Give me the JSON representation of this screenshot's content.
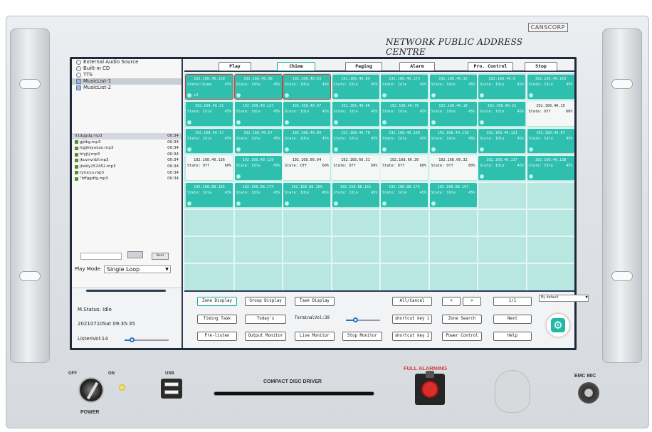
{
  "brand": "CANSCORP",
  "device_title": "NETWORK PUBLIC ADDRESS CENTRE",
  "sources": [
    {
      "label": "External Audio Source",
      "icon": "speaker-icon"
    },
    {
      "label": "Built-in CD",
      "icon": "speaker-icon"
    },
    {
      "label": "TTS",
      "icon": "speaker-icon"
    },
    {
      "label": "MusicList-1",
      "icon": "music-list-icon",
      "selected": true
    },
    {
      "label": "MusicList-2",
      "icon": "music-list-icon"
    }
  ],
  "files": [
    {
      "name": "01dggdg.mp3",
      "time": "00:34",
      "selected": true
    },
    {
      "name": "gjdkg.mp3",
      "time": "00:34"
    },
    {
      "name": "hgjjhkyuiuiu.mp3",
      "time": "00:34"
    },
    {
      "name": "htyjtj.mp3",
      "time": "00:34"
    },
    {
      "name": "jkuvnvnbf.mp3",
      "time": "00:34"
    },
    {
      "name": "jksiky252452.mp3",
      "time": "00:34"
    },
    {
      "name": "tytutyu.mp3",
      "time": "00:34"
    },
    {
      "name": "\"bffggdfg.mp3",
      "time": "00:34"
    }
  ],
  "play_controls": {
    "next_label": "Next"
  },
  "play_mode": {
    "label": "Play Mode",
    "value": "Single Loop"
  },
  "status": {
    "mstatus": "M.Status:  Idle",
    "datetime": "20210710Sat 09:35:35",
    "listen_vol": "ListenVol:14",
    "listen_vol_level": 0.18
  },
  "tabs": [
    {
      "label": "Play"
    },
    {
      "label": "Chime",
      "active": true
    },
    {
      "label": "Paging"
    },
    {
      "label": "Alarm"
    },
    {
      "label": "Pro. Control"
    },
    {
      "label": "Stop"
    }
  ],
  "zones": [
    [
      {
        "ip": "192.168.40.130",
        "state": "State:Chime",
        "vol": "45%",
        "extra": "x3",
        "sel": true
      },
      {
        "ip": "192.168.40.98",
        "state": "State: Idle",
        "vol": "45%",
        "sel": true
      },
      {
        "ip": "192.168.40.63",
        "state": "State: Idle",
        "vol": "45%",
        "sel": true
      },
      {
        "ip": "192.168.40.89",
        "state": "State: Idle",
        "vol": "45%"
      },
      {
        "ip": "192.168.40.173",
        "state": "State: Idle",
        "vol": "45%"
      },
      {
        "ip": "192.168.40.32",
        "state": "State: Idle",
        "vol": "45%"
      },
      {
        "ip": "192.168.40.9",
        "state": "State: Idle",
        "vol": "45%"
      },
      {
        "ip": "192.168.40.103",
        "state": "State: Idle",
        "vol": "45%"
      }
    ],
    [
      {
        "ip": "192.168.40.21",
        "state": "State: Idle",
        "vol": "45%"
      },
      {
        "ip": "192.168.40.127",
        "state": "State: Idle",
        "vol": "45%"
      },
      {
        "ip": "192.168.40.97",
        "state": "State: Idle",
        "vol": "45%"
      },
      {
        "ip": "192.168.40.66",
        "state": "State: Idle",
        "vol": "45%"
      },
      {
        "ip": "192.168.40.76",
        "state": "State: Idle",
        "vol": "45%"
      },
      {
        "ip": "192.168.40.18",
        "state": "State: Idle",
        "vol": "45%"
      },
      {
        "ip": "192.168.40.22",
        "state": "State: Idle",
        "vol": "45%"
      },
      {
        "ip": "192.168.40.15",
        "state": "State: Off",
        "vol": "60%",
        "off": true
      }
    ],
    [
      {
        "ip": "192.168.40.17",
        "state": "State: Idle",
        "vol": "45%"
      },
      {
        "ip": "192.168.40.67",
        "state": "State: Idle",
        "vol": "45%"
      },
      {
        "ip": "192.168.40.84",
        "state": "State: Idle",
        "vol": "45%"
      },
      {
        "ip": "192.168.40.78",
        "state": "State: Idle",
        "vol": "45%"
      },
      {
        "ip": "192.168.40.120",
        "state": "State: Idle",
        "vol": "45%"
      },
      {
        "ip": "192.168.40.118",
        "state": "State: Idle",
        "vol": "45%"
      },
      {
        "ip": "192.168.40.121",
        "state": "State: Idle",
        "vol": "45%"
      },
      {
        "ip": "192.168.40.87",
        "state": "State: Idle",
        "vol": "45%"
      }
    ],
    [
      {
        "ip": "192.168.40.136",
        "state": "State: Off",
        "vol": "60%",
        "off": true
      },
      {
        "ip": "192.168.40.129",
        "state": "State: Idle",
        "vol": "45%"
      },
      {
        "ip": "192.168.66.64",
        "state": "State: Off",
        "vol": "60%",
        "off": true
      },
      {
        "ip": "192.168.66.31",
        "state": "State: Off",
        "vol": "60%",
        "off": true
      },
      {
        "ip": "192.168.66.30",
        "state": "State: Off",
        "vol": "60%",
        "off": true
      },
      {
        "ip": "192.168.66.32",
        "state": "State: Off",
        "vol": "60%",
        "off": true
      },
      {
        "ip": "192.168.40.137",
        "state": "State: Idle",
        "vol": "45%"
      },
      {
        "ip": "192.168.40.138",
        "state": "State: Idle",
        "vol": "45%"
      }
    ],
    [
      {
        "ip": "192.168.88.165",
        "state": "State: Idle",
        "vol": "45%"
      },
      {
        "ip": "192.168.88.174",
        "state": "State: Idle",
        "vol": "45%"
      },
      {
        "ip": "192.168.88.169",
        "state": "State: Idle",
        "vol": "45%"
      },
      {
        "ip": "192.168.88.161",
        "state": "State: Idle",
        "vol": "45%"
      },
      {
        "ip": "192.168.88.175",
        "state": "State: Idle",
        "vol": "45%"
      },
      {
        "ip": "192.168.88.167",
        "state": "State: Idle",
        "vol": "45%"
      }
    ]
  ],
  "bottom": {
    "zone_display": "Zone Display",
    "group_display": "Group Display",
    "task_display": "Task Display",
    "all_cancel": "All/Cancel",
    "prev": "<",
    "next_arrow": ">",
    "page": "1/1",
    "sort": "By default",
    "timing_task": "Timing Task",
    "todays": "Today's",
    "terminal_vol": "TerminalVol:30",
    "terminal_vol_level": 0.3,
    "shortcut1": "shortcut key 1",
    "zone_search": "Zone Search",
    "next": "Next",
    "pre_listen": "Pre-listen",
    "output_monitor": "Output Monitor",
    "live_monitor": "Live Monitor",
    "stop_monitor": "Stop Monitor",
    "shortcut2": "shortcut key 2",
    "power_control": "Power Control",
    "help": "Help"
  },
  "hardware": {
    "off": "OFF",
    "on": "ON",
    "power": "POWER",
    "usb": "USB",
    "cd": "COMPACT DISC DRIVER",
    "alarm": "FULL ALARMING",
    "emc": "EMC MIC"
  },
  "colors": {
    "zone_active": "#2fbfae",
    "zone_off": "#f5f7f7",
    "accent": "#1aa89a",
    "alarm": "#d92f2a"
  }
}
